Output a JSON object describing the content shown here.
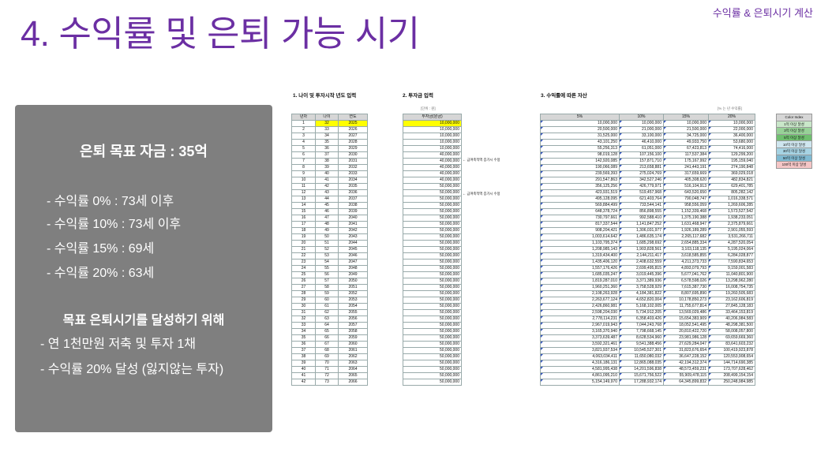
{
  "slide": {
    "title": "4. 수익률 및 은퇴 가능 시기",
    "corner_label": "수익률 & 은퇴시기 계산"
  },
  "panel": {
    "goal": "은퇴 목표 자금 : 35억",
    "rates": [
      "- 수익률   0% : 73세 이후",
      "- 수익률 10% : 73세 이후",
      "- 수익률 15% : 69세",
      "- 수익률 20% : 63세"
    ],
    "subtitle": "목표 은퇴시기를 달성하기 위해",
    "actions": [
      "- 연 1천만원 저축 및 투자 1채",
      "- 수익률 20% 달성 (잃지않는 투자)"
    ]
  },
  "colors": {
    "accent": "#6b2fa3",
    "panel": "#7f7f7f",
    "highlight": "#ffff00",
    "flag": "#2d4fb8"
  },
  "sheet": {
    "section1": "1. 나이 및 투자시작 년도 입력",
    "section2": "2. 투자금 입력",
    "section3": "3. 수익률에 따른 자산",
    "unit_left": "[단위 : 원]",
    "unit_right": "[% 는 년 수익률]",
    "headers1": [
      "년차",
      "나이",
      "연도"
    ],
    "header2": "투자금(원금)",
    "headers3": [
      "5%",
      "10%",
      "15%",
      "20%"
    ],
    "note1": "← 급여축적액 증가시 수정",
    "note2": "← 급여축적액 증가시 수정",
    "rows": [
      [
        "1",
        "32",
        "2025",
        "10,000,000",
        "10,000,000",
        "10,000,000",
        "10,000,000",
        "10,000,000"
      ],
      [
        "2",
        "33",
        "2026",
        "10,000,000",
        "20,500,000",
        "21,000,000",
        "21,500,000",
        "22,000,000"
      ],
      [
        "3",
        "34",
        "2027",
        "10,000,000",
        "31,525,000",
        "33,100,000",
        "34,725,000",
        "36,400,000"
      ],
      [
        "4",
        "35",
        "2028",
        "10,000,000",
        "43,101,250",
        "46,410,000",
        "49,933,750",
        "53,680,000"
      ],
      [
        "5",
        "36",
        "2029",
        "10,000,000",
        "55,256,313",
        "61,051,000",
        "67,423,813",
        "74,416,000"
      ],
      [
        "6",
        "37",
        "2030",
        "40,000,000",
        "98,019,128",
        "107,156,100",
        "117,537,384",
        "129,299,200"
      ],
      [
        "7",
        "38",
        "2031",
        "40,000,000",
        "142,920,085",
        "157,871,710",
        "175,167,992",
        "195,159,040"
      ],
      [
        "8",
        "39",
        "2032",
        "40,000,000",
        "190,066,089",
        "213,658,881",
        "241,443,191",
        "274,190,848"
      ],
      [
        "9",
        "40",
        "2033",
        "40,000,000",
        "239,569,393",
        "275,024,769",
        "317,659,669",
        "369,029,018"
      ],
      [
        "10",
        "41",
        "2034",
        "40,000,000",
        "291,547,863",
        "342,527,246",
        "405,308,620",
        "482,834,821"
      ],
      [
        "11",
        "42",
        "2035",
        "50,000,000",
        "356,125,256",
        "426,779,971",
        "516,104,913",
        "629,401,785"
      ],
      [
        "12",
        "43",
        "2036",
        "50,000,000",
        "423,931,519",
        "519,457,968",
        "643,520,650",
        "805,282,142"
      ],
      [
        "13",
        "44",
        "2037",
        "50,000,000",
        "495,128,095",
        "621,403,764",
        "790,048,747",
        "1,016,338,571"
      ],
      [
        "14",
        "45",
        "2038",
        "50,000,000",
        "569,884,499",
        "733,544,141",
        "958,556,059",
        "1,269,606,285"
      ],
      [
        "15",
        "46",
        "2039",
        "50,000,000",
        "648,378,724",
        "856,898,555",
        "1,152,339,468",
        "1,573,527,542"
      ],
      [
        "16",
        "47",
        "2040",
        "50,000,000",
        "730,797,661",
        "992,588,410",
        "1,375,190,388",
        "1,938,233,051"
      ],
      [
        "17",
        "48",
        "2041",
        "50,000,000",
        "817,337,544",
        "1,141,847,252",
        "1,631,468,947",
        "2,375,879,661"
      ],
      [
        "18",
        "49",
        "2042",
        "50,000,000",
        "908,204,421",
        "1,306,031,977",
        "1,926,189,289",
        "2,901,055,593"
      ],
      [
        "19",
        "50",
        "2043",
        "50,000,000",
        "1,003,614,642",
        "1,486,635,174",
        "2,265,117,682",
        "3,531,266,711"
      ],
      [
        "20",
        "51",
        "2044",
        "50,000,000",
        "1,103,795,374",
        "1,685,298,692",
        "2,654,885,334",
        "4,287,520,054"
      ],
      [
        "21",
        "52",
        "2045",
        "50,000,000",
        "1,208,985,143",
        "1,903,828,561",
        "3,103,118,135",
        "5,195,024,064"
      ],
      [
        "22",
        "53",
        "2046",
        "50,000,000",
        "1,319,434,400",
        "2,144,211,417",
        "3,618,585,855",
        "6,284,028,877"
      ],
      [
        "23",
        "54",
        "2047",
        "50,000,000",
        "1,435,406,120",
        "2,408,632,559",
        "4,211,373,733",
        "7,590,834,653"
      ],
      [
        "24",
        "55",
        "2048",
        "50,000,000",
        "1,557,176,426",
        "2,699,495,815",
        "4,893,079,793",
        "9,159,001,583"
      ],
      [
        "25",
        "56",
        "2049",
        "50,000,000",
        "1,685,035,247",
        "3,019,445,396",
        "5,677,041,762",
        "11,040,801,900"
      ],
      [
        "26",
        "57",
        "2050",
        "50,000,000",
        "1,819,287,010",
        "3,371,389,936",
        "6,578,598,026",
        "13,298,962,280"
      ],
      [
        "27",
        "58",
        "2051",
        "50,000,000",
        "1,960,251,360",
        "3,758,528,929",
        "7,615,387,730",
        "16,008,754,735"
      ],
      [
        "28",
        "59",
        "2052",
        "50,000,000",
        "2,108,263,928",
        "4,184,381,822",
        "8,807,695,890",
        "19,260,505,683"
      ],
      [
        "29",
        "60",
        "2053",
        "50,000,000",
        "2,263,677,124",
        "4,652,820,004",
        "10,178,850,273",
        "23,162,606,819"
      ],
      [
        "30",
        "61",
        "2054",
        "50,000,000",
        "2,426,860,981",
        "5,168,102,005",
        "11,755,677,814",
        "27,845,128,183"
      ],
      [
        "31",
        "62",
        "2055",
        "50,000,000",
        "2,598,204,030",
        "5,734,912,205",
        "13,569,029,486",
        "33,464,153,819"
      ],
      [
        "32",
        "63",
        "2056",
        "50,000,000",
        "2,778,114,231",
        "6,358,403,426",
        "15,654,383,909",
        "40,206,984,583"
      ],
      [
        "33",
        "64",
        "2057",
        "50,000,000",
        "2,967,019,943",
        "7,044,243,768",
        "18,052,541,495",
        "48,298,381,500"
      ],
      [
        "34",
        "65",
        "2058",
        "50,000,000",
        "3,165,370,940",
        "7,798,668,145",
        "20,810,422,720",
        "58,008,057,800"
      ],
      [
        "35",
        "66",
        "2059",
        "50,000,000",
        "3,373,639,487",
        "8,628,534,960",
        "23,981,986,128",
        "69,659,669,360"
      ],
      [
        "36",
        "67",
        "2060",
        "50,000,000",
        "3,592,321,461",
        "9,541,388,456",
        "27,629,284,047",
        "83,641,603,232"
      ],
      [
        "37",
        "68",
        "2061",
        "50,000,000",
        "3,821,937,534",
        "10,545,527,301",
        "31,823,676,654",
        "100,419,923,878"
      ],
      [
        "38",
        "69",
        "2062",
        "50,000,000",
        "4,063,034,411",
        "11,650,080,032",
        "36,647,228,152",
        "120,553,908,654"
      ],
      [
        "39",
        "70",
        "2063",
        "50,000,000",
        "4,316,186,131",
        "12,865,088,035",
        "42,194,312,374",
        "144,714,690,385"
      ],
      [
        "40",
        "71",
        "2064",
        "50,000,000",
        "4,581,995,438",
        "14,201,596,838",
        "48,573,459,231",
        "173,707,628,462"
      ],
      [
        "41",
        "72",
        "2065",
        "50,000,000",
        "4,861,095,210",
        "15,671,756,522",
        "55,909,478,115",
        "208,499,154,154"
      ],
      [
        "42",
        "73",
        "2066",
        "50,000,000",
        "5,154,149,970",
        "17,288,932,174",
        "64,345,899,832",
        "250,248,984,985"
      ]
    ],
    "legend": {
      "title": "Color Index",
      "items": [
        {
          "label": "1억 이상 달성",
          "color": "#c9e7c9"
        },
        {
          "label": "3억 이상 달성",
          "color": "#97d197"
        },
        {
          "label": "5억 이상 달성",
          "color": "#6fbf6f"
        },
        {
          "label": "10억 이상 달성",
          "color": "#cfe6ef"
        },
        {
          "label": "30억 이상 달성",
          "color": "#a6d3e3"
        },
        {
          "label": "50억 이상 달성",
          "color": "#7fbad2"
        },
        {
          "label": "100억 이상 달성",
          "color": "#f5c6c6"
        }
      ]
    }
  }
}
